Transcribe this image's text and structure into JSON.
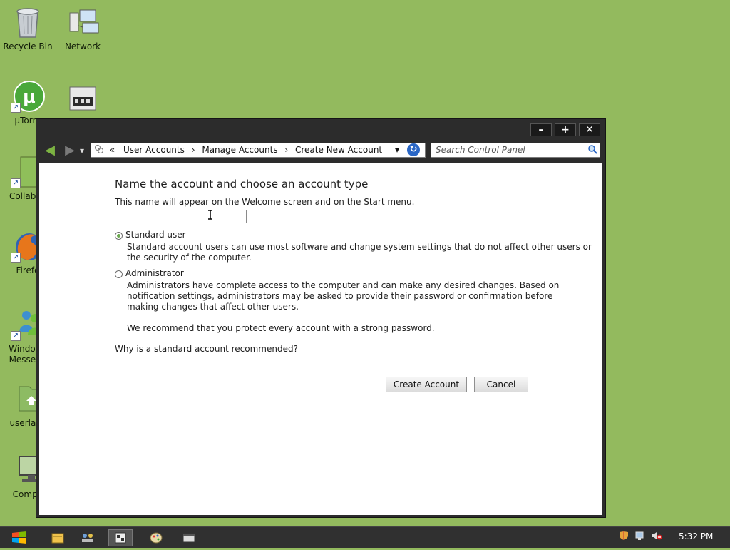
{
  "desktop": {
    "icons": [
      {
        "name": "recycle-bin",
        "label": "Recycle Bin"
      },
      {
        "name": "network",
        "label": "Network"
      },
      {
        "name": "utorrent",
        "label": "µTorre"
      },
      {
        "name": "media-device",
        "label": ""
      },
      {
        "name": "collabsync",
        "label": "CollabSy"
      },
      {
        "name": "firefox",
        "label": "Firefo"
      },
      {
        "name": "windows-messenger",
        "label": "Windows\nMesseng"
      },
      {
        "name": "userlanc",
        "label": "userlanc"
      },
      {
        "name": "computer",
        "label": "Compu"
      }
    ]
  },
  "window": {
    "controls": {
      "minimize": "–",
      "maximize": "+",
      "close": "✕"
    },
    "nav": {
      "back": "◀",
      "forward": "▶",
      "recent": "▾"
    },
    "address": {
      "prefix": "«",
      "crumbs": [
        "User Accounts",
        "Manage Accounts",
        "Create New Account"
      ],
      "separator": "›",
      "dropdown": "▾"
    },
    "refresh": "↻",
    "search": {
      "placeholder": "Search Control Panel"
    },
    "content": {
      "heading": "Name the account and choose an account type",
      "subtext": "This name will appear on the Welcome screen and on the Start menu.",
      "name_value": "",
      "standard": {
        "label": "Standard user",
        "desc_line1": "Standard account users can use most software and change system settings that do not affect other users or",
        "desc_line2": "the security of the computer.",
        "selected": true
      },
      "admin": {
        "label": "Administrator",
        "desc_line1": "Administrators have complete access to the computer and can make any desired changes. Based on",
        "desc_line2": "notification settings, administrators may be asked to provide their password or confirmation before",
        "desc_line3": "making changes that affect other users.",
        "selected": false
      },
      "recommend": "We recommend that you protect every account with a strong password.",
      "why_link": "Why is a standard account recommended?",
      "create_button": "Create Account",
      "cancel_button": "Cancel"
    }
  },
  "taskbar": {
    "clock": "5:32 PM"
  },
  "colors": {
    "desktop": "#93ba5e",
    "window_frame": "#2c2c2c",
    "taskbar": "#303030",
    "radio_selected": "#6aa84f"
  }
}
